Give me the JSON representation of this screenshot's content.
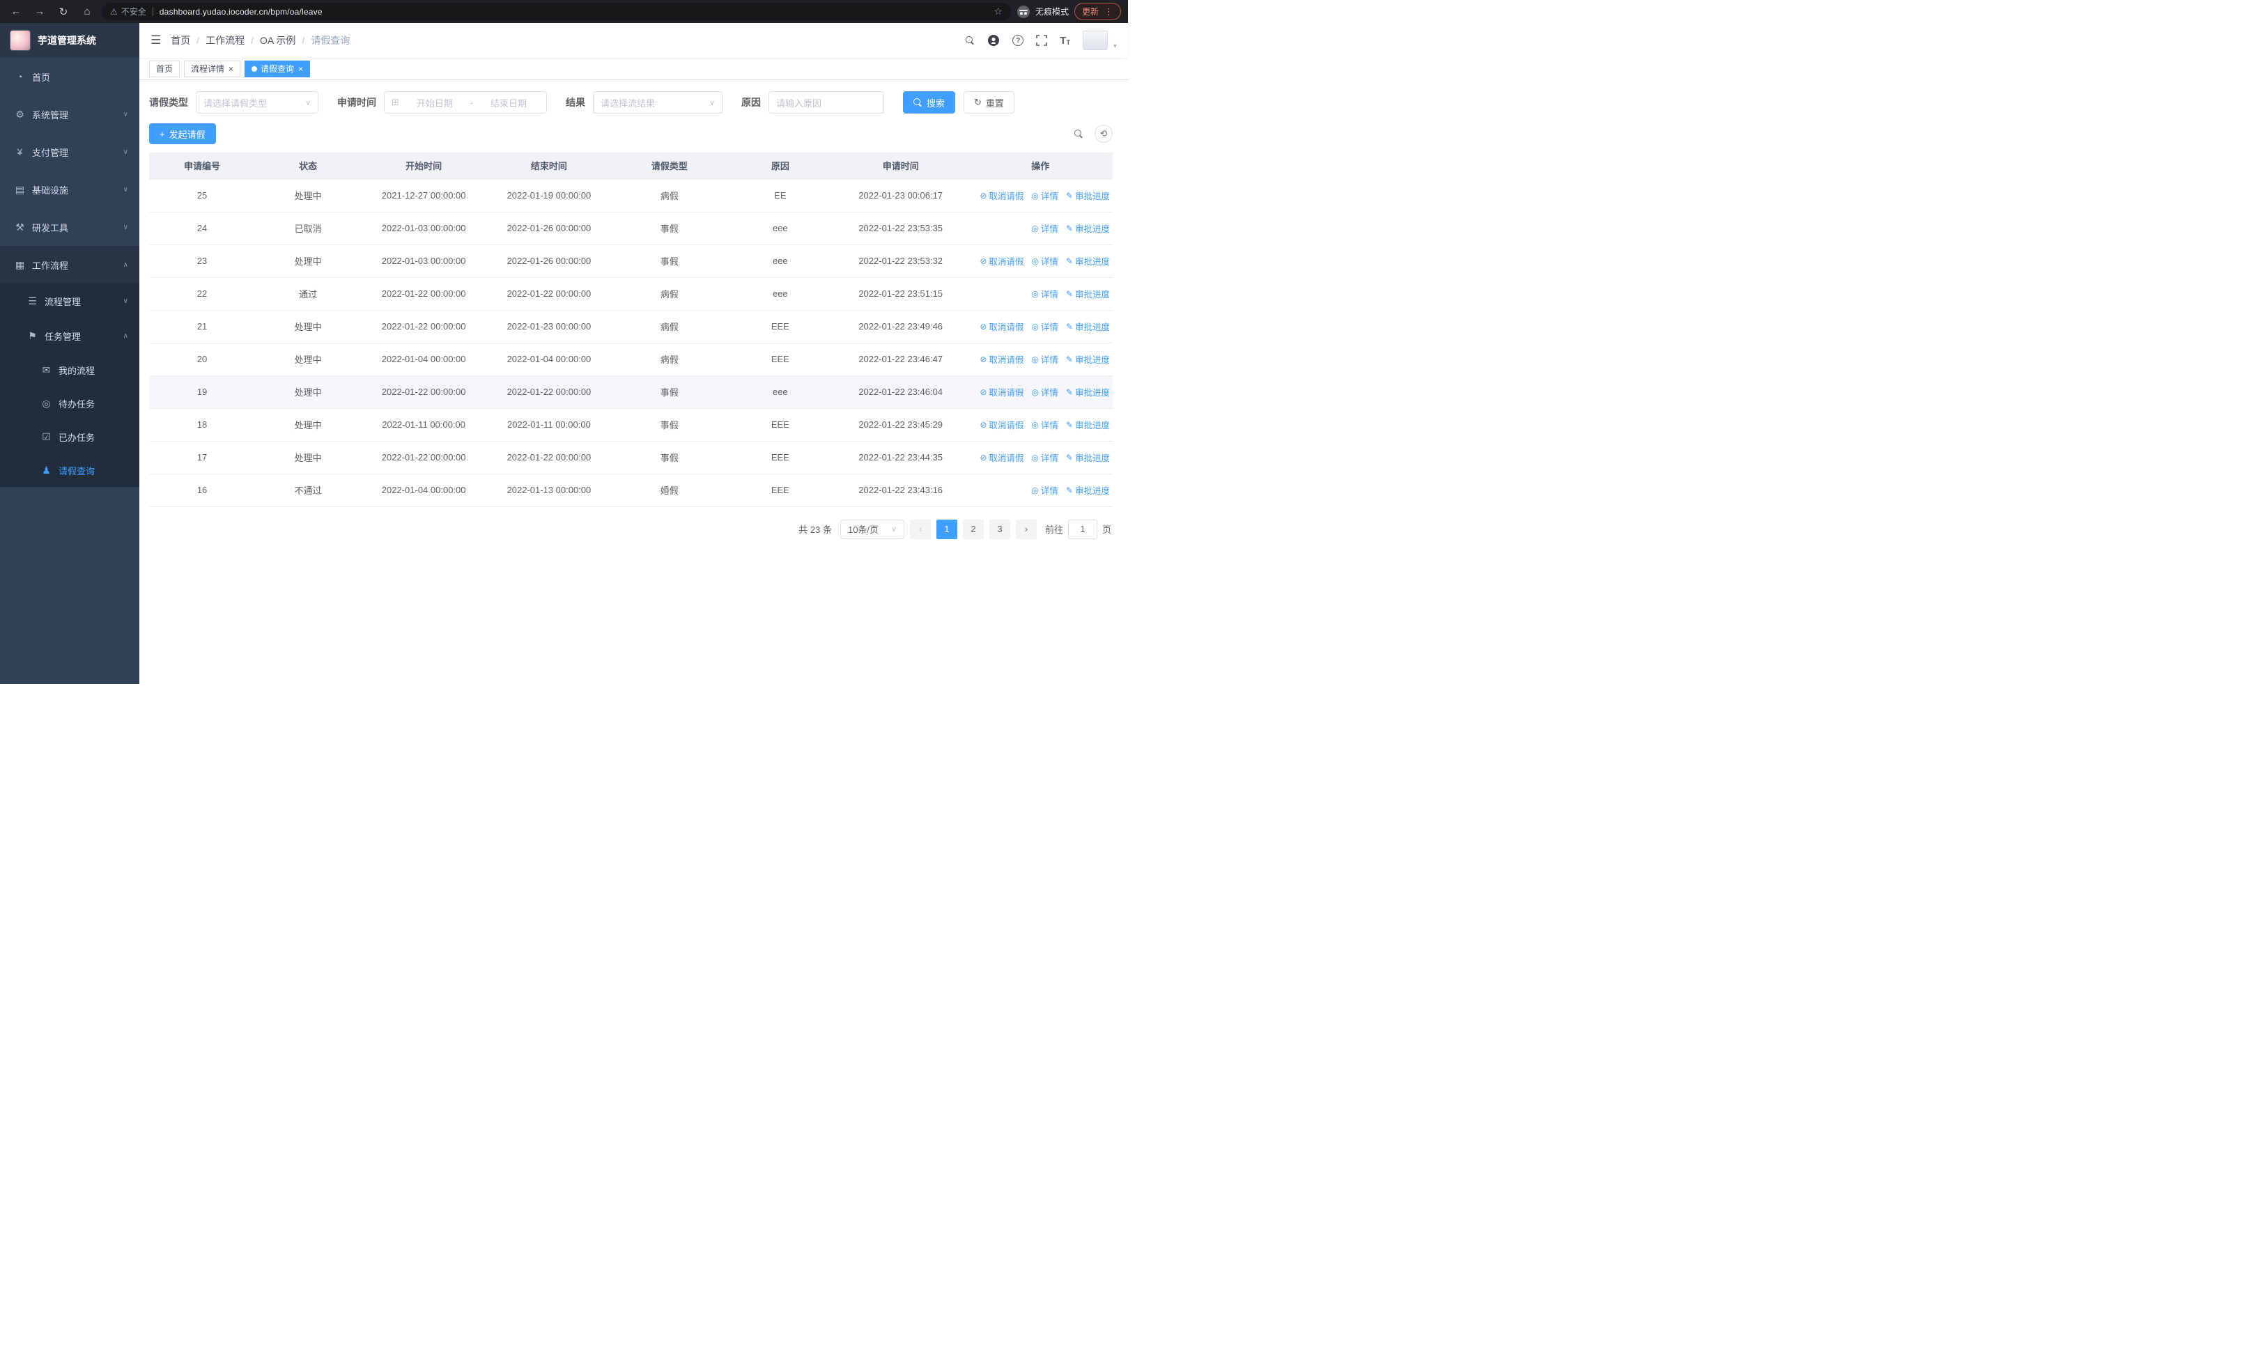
{
  "browser": {
    "security_chip": "不安全",
    "url": "dashboard.yudao.iocoder.cn/bpm/oa/leave",
    "incognito_label": "无痕模式",
    "update_label": "更新"
  },
  "sidebar": {
    "logo_title": "芋道管理系统",
    "items": [
      {
        "key": "home",
        "label": "首页",
        "icon": "dashboard-icon",
        "level": 1,
        "chevron": null,
        "active": false,
        "open": false
      },
      {
        "key": "system",
        "label": "系统管理",
        "icon": "gear-icon",
        "level": 1,
        "chevron": "down",
        "active": false,
        "open": false
      },
      {
        "key": "payment",
        "label": "支付管理",
        "icon": "yen-icon",
        "level": 1,
        "chevron": "down",
        "active": false,
        "open": false
      },
      {
        "key": "infrastructure",
        "label": "基础设施",
        "icon": "monitor-icon",
        "level": 1,
        "chevron": "down",
        "active": false,
        "open": false
      },
      {
        "key": "dev-tools",
        "label": "研发工具",
        "icon": "tools-icon",
        "level": 1,
        "chevron": "down",
        "active": false,
        "open": false
      },
      {
        "key": "workflow",
        "label": "工作流程",
        "icon": "workflow-icon",
        "level": 1,
        "chevron": "up",
        "active": false,
        "open": true
      },
      {
        "key": "process-mgmt",
        "label": "流程管理",
        "icon": "list-icon",
        "level": 2,
        "chevron": "down",
        "active": false,
        "open": false
      },
      {
        "key": "task-mgmt",
        "label": "任务管理",
        "icon": "flag-icon",
        "level": 2,
        "chevron": "up",
        "active": false,
        "open": false
      },
      {
        "key": "my-process",
        "label": "我的流程",
        "icon": "message-icon",
        "level": 3,
        "chevron": null,
        "active": false,
        "open": false
      },
      {
        "key": "todo-tasks",
        "label": "待办任务",
        "icon": "eye-icon",
        "level": 3,
        "chevron": null,
        "active": false,
        "open": false
      },
      {
        "key": "done-tasks",
        "label": "已办任务",
        "icon": "check-icon",
        "level": 3,
        "chevron": null,
        "active": false,
        "open": false
      },
      {
        "key": "leave-query",
        "label": "请假查询",
        "icon": "user-icon",
        "level": 3,
        "chevron": null,
        "active": true,
        "open": false
      }
    ]
  },
  "header": {
    "breadcrumb": [
      "首页",
      "工作流程",
      "OA 示例",
      "请假查询"
    ]
  },
  "tabs": [
    {
      "label": "首页"
    },
    {
      "label": "流程详情"
    },
    {
      "label": "请假查询"
    }
  ],
  "filters": {
    "leave_type_label": "请假类型",
    "leave_type_placeholder": "请选择请假类型",
    "apply_time_label": "申请时间",
    "start_date_placeholder": "开始日期",
    "date_separator": "-",
    "end_date_placeholder": "结束日期",
    "result_label": "结果",
    "result_placeholder": "请选择流结果",
    "reason_label": "原因",
    "reason_placeholder": "请输入原因",
    "search_button": "搜索",
    "reset_button": "重置"
  },
  "toolbar": {
    "create_button": "发起请假"
  },
  "table": {
    "columns": [
      "申请编号",
      "状态",
      "开始时间",
      "结束时间",
      "请假类型",
      "原因",
      "申请时间",
      "操作"
    ],
    "action_defs": {
      "cancel": {
        "label": "取消请假",
        "icon": "delete-icon"
      },
      "detail": {
        "label": "详情",
        "icon": "eye-icon"
      },
      "progress": {
        "label": "审批进度",
        "icon": "edit-icon"
      }
    },
    "rows": [
      {
        "id": "25",
        "status": "处理中",
        "start": "2021-12-27 00:00:00",
        "end": "2022-01-19 00:00:00",
        "type": "病假",
        "reason": "EE",
        "apply_time": "2022-01-23 00:06:17",
        "actions": [
          "cancel",
          "detail",
          "progress"
        ],
        "highlighted": false
      },
      {
        "id": "24",
        "status": "已取消",
        "start": "2022-01-03 00:00:00",
        "end": "2022-01-26 00:00:00",
        "type": "事假",
        "reason": "eee",
        "apply_time": "2022-01-22 23:53:35",
        "actions": [
          "detail",
          "progress"
        ],
        "highlighted": false
      },
      {
        "id": "23",
        "status": "处理中",
        "start": "2022-01-03 00:00:00",
        "end": "2022-01-26 00:00:00",
        "type": "事假",
        "reason": "eee",
        "apply_time": "2022-01-22 23:53:32",
        "actions": [
          "cancel",
          "detail",
          "progress"
        ],
        "highlighted": false
      },
      {
        "id": "22",
        "status": "通过",
        "start": "2022-01-22 00:00:00",
        "end": "2022-01-22 00:00:00",
        "type": "病假",
        "reason": "eee",
        "apply_time": "2022-01-22 23:51:15",
        "actions": [
          "detail",
          "progress"
        ],
        "highlighted": false
      },
      {
        "id": "21",
        "status": "处理中",
        "start": "2022-01-22 00:00:00",
        "end": "2022-01-23 00:00:00",
        "type": "病假",
        "reason": "EEE",
        "apply_time": "2022-01-22 23:49:46",
        "actions": [
          "cancel",
          "detail",
          "progress"
        ],
        "highlighted": false
      },
      {
        "id": "20",
        "status": "处理中",
        "start": "2022-01-04 00:00:00",
        "end": "2022-01-04 00:00:00",
        "type": "病假",
        "reason": "EEE",
        "apply_time": "2022-01-22 23:46:47",
        "actions": [
          "cancel",
          "detail",
          "progress"
        ],
        "highlighted": false
      },
      {
        "id": "19",
        "status": "处理中",
        "start": "2022-01-22 00:00:00",
        "end": "2022-01-22 00:00:00",
        "type": "事假",
        "reason": "eee",
        "apply_time": "2022-01-22 23:46:04",
        "actions": [
          "cancel",
          "detail",
          "progress"
        ],
        "highlighted": true
      },
      {
        "id": "18",
        "status": "处理中",
        "start": "2022-01-11 00:00:00",
        "end": "2022-01-11 00:00:00",
        "type": "事假",
        "reason": "EEE",
        "apply_time": "2022-01-22 23:45:29",
        "actions": [
          "cancel",
          "detail",
          "progress"
        ],
        "highlighted": false
      },
      {
        "id": "17",
        "status": "处理中",
        "start": "2022-01-22 00:00:00",
        "end": "2022-01-22 00:00:00",
        "type": "事假",
        "reason": "EEE",
        "apply_time": "2022-01-22 23:44:35",
        "actions": [
          "cancel",
          "detail",
          "progress"
        ],
        "highlighted": false
      },
      {
        "id": "16",
        "status": "不通过",
        "start": "2022-01-04 00:00:00",
        "end": "2022-01-13 00:00:00",
        "type": "婚假",
        "reason": "EEE",
        "apply_time": "2022-01-22 23:43:16",
        "actions": [
          "detail",
          "progress"
        ],
        "highlighted": false
      }
    ]
  },
  "pagination": {
    "total_text": "共 23 条",
    "page_size": "10条/页",
    "pages": [
      "1",
      "2",
      "3"
    ],
    "current_page": "1",
    "goto_label": "前往",
    "goto_value": "1",
    "page_unit": "页"
  }
}
